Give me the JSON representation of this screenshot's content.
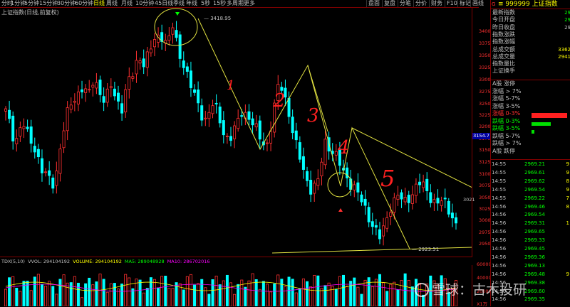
{
  "timeframes": [
    "分时",
    "1分钟",
    "5分钟",
    "15分钟",
    "30分钟",
    "60分钟",
    "日线",
    "周线",
    "月线",
    "10分钟",
    "45日线",
    "季线",
    "年线",
    "5秒",
    "15秒",
    "多周期",
    "更多"
  ],
  "active_timeframe": "日线",
  "toolbar_right": [
    "盘面",
    "复盘",
    "分笔",
    "分价",
    "财务",
    "F10",
    "标记",
    "画线"
  ],
  "chart_title": "上证指数(日线,前复权)",
  "high_label": "3418.95",
  "low_label": "2923.51",
  "last_price_tag": "3154.7",
  "cur_price_label": "3021",
  "price_axis": [
    {
      "v": "3400",
      "y": 34
    },
    {
      "v": "3375",
      "y": 51
    },
    {
      "v": "3350",
      "y": 68
    },
    {
      "v": "3325",
      "y": 85
    },
    {
      "v": "3300",
      "y": 102
    },
    {
      "v": "3275",
      "y": 119
    },
    {
      "v": "3250",
      "y": 136
    },
    {
      "v": "3225",
      "y": 152
    },
    {
      "v": "3200",
      "y": 168
    },
    {
      "v": "3175",
      "y": 185
    },
    {
      "v": "3150",
      "y": 201
    },
    {
      "v": "3125",
      "y": 218
    },
    {
      "v": "3100",
      "y": 235
    },
    {
      "v": "3075",
      "y": 251
    },
    {
      "v": "3050",
      "y": 268
    },
    {
      "v": "3025",
      "y": 284
    },
    {
      "v": "3000",
      "y": 300
    },
    {
      "v": "2975",
      "y": 317
    },
    {
      "v": "2950",
      "y": 333
    }
  ],
  "volume_legend": {
    "indicator": "TDX(5,10)",
    "vol": "VVOL: 294104192",
    "volume": "VOLUME: 294104192",
    "ma5": "MA5: 289048928",
    "ma10": "MA10: 286702016"
  },
  "volume_axis": [
    "60000",
    "40000",
    "20000",
    "X1万"
  ],
  "annotations": [
    "1",
    "2",
    "3",
    "4",
    "5"
  ],
  "right_panel": {
    "marker": "G",
    "code_title": "≡ 999999 上证指数",
    "rows": [
      {
        "label": "最新指数",
        "value": "29",
        "color": "#00ff00"
      },
      {
        "label": "今日开盘",
        "value": "29",
        "color": "#00ff00"
      },
      {
        "label": "昨日收盘",
        "value": "29",
        "color": "#c0c0c0"
      },
      {
        "label": "指数涨跌",
        "value": "",
        "color": "#c0c0c0"
      },
      {
        "label": "指数涨幅",
        "value": "",
        "color": "#c0c0c0"
      },
      {
        "label": "总成交额",
        "value": "3362",
        "color": "#ffff00"
      },
      {
        "label": "总成交量",
        "value": "2941",
        "color": "#ffff00"
      },
      {
        "label": "指数量比",
        "value": "",
        "color": "#c0c0c0"
      },
      {
        "label": "上证换手",
        "value": "",
        "color": "#c0c0c0"
      }
    ],
    "breadth": [
      {
        "label": "A股 涨停",
        "color": "#c0c0c0"
      },
      {
        "label": "涨幅 > 7%",
        "color": "#c0c0c0"
      },
      {
        "label": "涨幅 5-7%",
        "color": "#c0c0c0"
      },
      {
        "label": "涨幅 3-5%",
        "color": "#c0c0c0"
      },
      {
        "label": "涨幅 0-3%",
        "color": "#ff3030"
      },
      {
        "label": "跌幅 0-3%",
        "color": "#00ff00"
      },
      {
        "label": "跌幅 3-5%",
        "color": "#00ff00"
      },
      {
        "label": "跌幅 5-7%",
        "color": "#c0c0c0"
      },
      {
        "label": "跌幅 > 7%",
        "color": "#c0c0c0"
      },
      {
        "label": "A股 跌停",
        "color": "#c0c0c0"
      }
    ],
    "ticks": [
      {
        "t": "14:55",
        "p": "2969.21",
        "v": "9"
      },
      {
        "t": "14:55",
        "p": "2969.61",
        "v": "9"
      },
      {
        "t": "14:55",
        "p": "2969.62",
        "v": "8"
      },
      {
        "t": "14:55",
        "p": "2969.54",
        "v": "9"
      },
      {
        "t": "14:55",
        "p": "2969.22",
        "v": "7"
      },
      {
        "t": "14:56",
        "p": "2969.46",
        "v": "8"
      },
      {
        "t": "14:56",
        "p": "2969.54",
        "v": ""
      },
      {
        "t": "14:56",
        "p": "2969.31",
        "v": "1"
      },
      {
        "t": "14:56",
        "p": "2969.65",
        "v": ""
      },
      {
        "t": "14:56",
        "p": "2969.33",
        "v": ""
      },
      {
        "t": "14:56",
        "p": "2969.45",
        "v": ""
      },
      {
        "t": "14:56",
        "p": "2969.36",
        "v": ""
      },
      {
        "t": "14:56",
        "p": "2969.13",
        "v": ""
      },
      {
        "t": "14:56",
        "p": "2969.48",
        "v": "9"
      },
      {
        "t": "14:56",
        "p": "2969.38",
        "v": ""
      },
      {
        "t": "14:56",
        "p": "2969.60",
        "v": ""
      },
      {
        "t": "14:56",
        "p": "2969.35",
        "v": ""
      }
    ]
  },
  "watermark": "雪球：古木投研",
  "colors": {
    "up": "#ff3030",
    "down": "#00ffff",
    "accent": "#ffff00",
    "grid": "#800000"
  },
  "chart_data": {
    "type": "candlestick",
    "note": "上证指数 daily candles, values read approximately from price axis",
    "high": 3418.95,
    "low": 2923.51,
    "ylim": [
      2925,
      3425
    ]
  }
}
